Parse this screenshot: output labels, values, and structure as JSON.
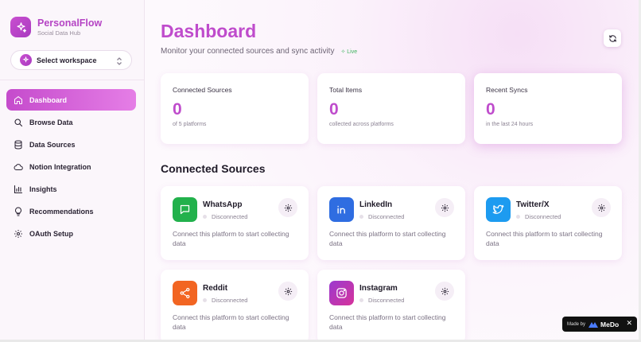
{
  "brand": {
    "name": "PersonalFlow",
    "subtitle": "Social Data Hub"
  },
  "workspace": {
    "label": "Select workspace"
  },
  "nav": [
    {
      "label": "Dashboard",
      "icon": "home-icon",
      "active": true
    },
    {
      "label": "Browse Data",
      "icon": "search-icon",
      "active": false
    },
    {
      "label": "Data Sources",
      "icon": "database-icon",
      "active": false
    },
    {
      "label": "Notion Integration",
      "icon": "cloud-icon",
      "active": false
    },
    {
      "label": "Insights",
      "icon": "bar-chart-icon",
      "active": false
    },
    {
      "label": "Recommendations",
      "icon": "lightbulb-icon",
      "active": false
    },
    {
      "label": "OAuth Setup",
      "icon": "gear-icon",
      "active": false
    }
  ],
  "header": {
    "title": "Dashboard",
    "subtitle": "Monitor your connected sources and sync activity",
    "live": "Live"
  },
  "stats": [
    {
      "label": "Connected Sources",
      "value": "0",
      "note": "of 5 platforms"
    },
    {
      "label": "Total Items",
      "value": "0",
      "note": "collected across platforms"
    },
    {
      "label": "Recent Syncs",
      "value": "0",
      "note": "in the last 24 hours"
    }
  ],
  "section_title": "Connected Sources",
  "sources": [
    {
      "name": "WhatsApp",
      "status": "Disconnected",
      "desc": "Connect this platform to start collecting data",
      "color": "#22b14c",
      "icon": "whatsapp-icon"
    },
    {
      "name": "LinkedIn",
      "status": "Disconnected",
      "desc": "Connect this platform to start collecting data",
      "color": "#2f6de1",
      "icon": "linkedin-icon"
    },
    {
      "name": "Twitter/X",
      "status": "Disconnected",
      "desc": "Connect this platform to start collecting data",
      "color": "#1d9bf0",
      "icon": "twitter-icon"
    },
    {
      "name": "Reddit",
      "status": "Disconnected",
      "desc": "Connect this platform to start collecting data",
      "color": "#f26522",
      "icon": "share-icon"
    },
    {
      "name": "Instagram",
      "status": "Disconnected",
      "desc": "Connect this platform to start collecting data",
      "color": "#c13584",
      "icon": "instagram-icon"
    }
  ],
  "badge": {
    "made_by": "Made by",
    "brand": "MeDo"
  },
  "colors": {
    "accent": "#bf4ccc",
    "active_nav": "#c54bcc",
    "live": "#3fb45f"
  }
}
